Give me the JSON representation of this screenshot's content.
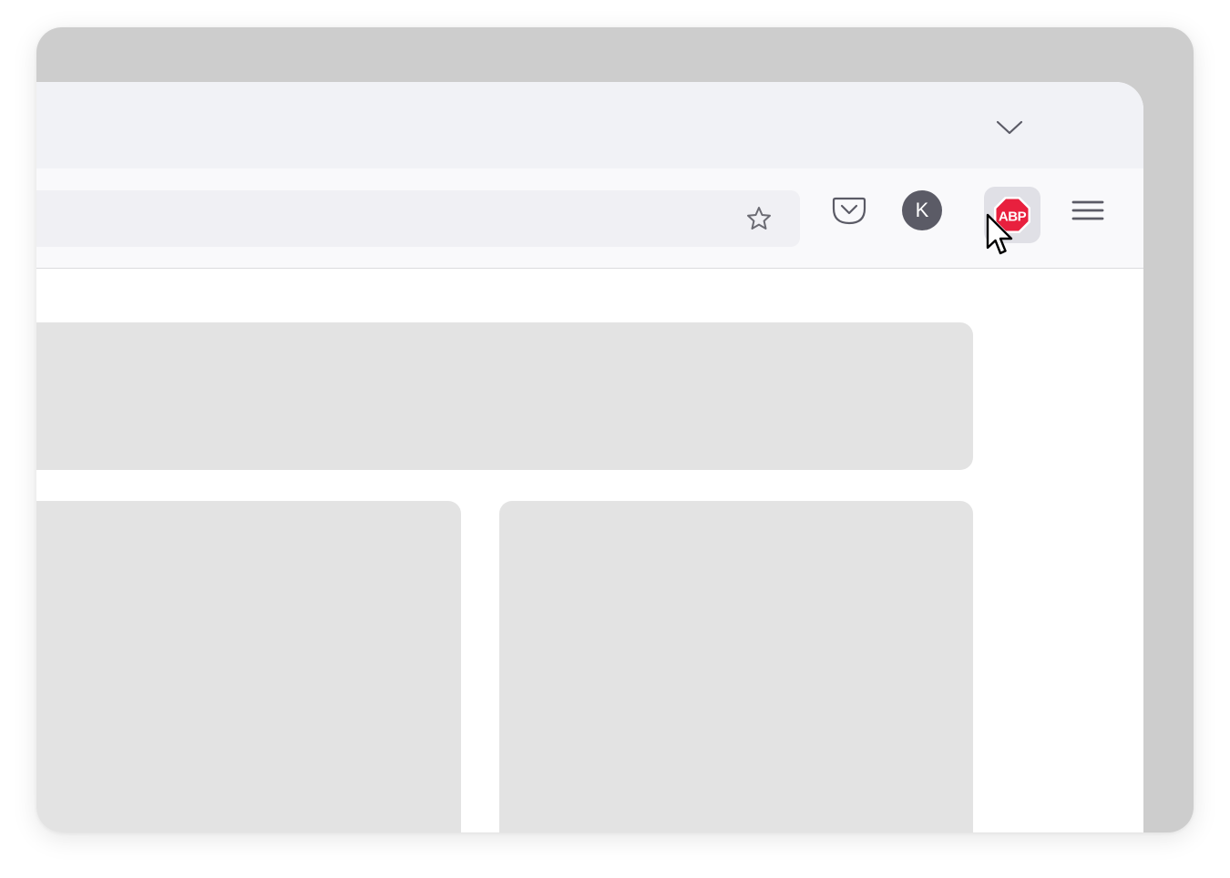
{
  "toolbar": {
    "account_initial": "K",
    "abp_label": "ABP"
  },
  "colors": {
    "frame_background": "#cdcdcd",
    "tabstrip_background": "#f1f2f6",
    "toolbar_background": "#f9f9fb",
    "urlbar_background": "#f0f0f4",
    "placeholder_card": "#e3e3e3",
    "avatar_background": "#5b5b66",
    "abp_red": "#e8203e",
    "abp_button_highlight": "#e0e0e6"
  },
  "icons": {
    "tab_list": "chevron-down-icon",
    "bookmark": "star-icon",
    "pocket": "pocket-icon",
    "abp": "adblock-plus-icon",
    "menu": "hamburger-menu-icon",
    "cursor": "mouse-pointer-icon"
  }
}
